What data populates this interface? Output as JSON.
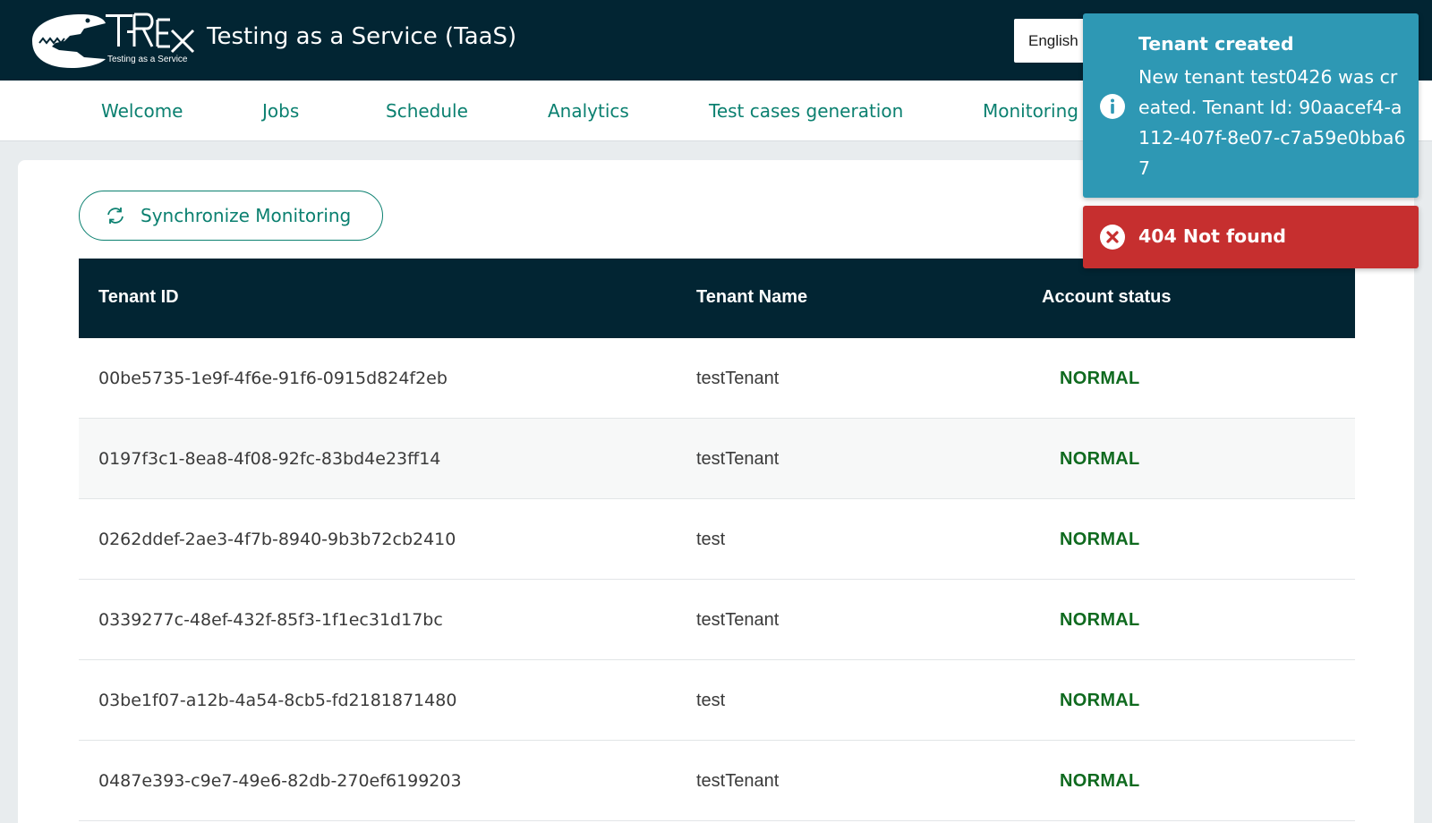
{
  "header": {
    "logo_text": "T-Rex",
    "logo_subtitle": "Testing as a Service",
    "title": "Testing as a Service (TaaS)",
    "language": "English"
  },
  "nav": {
    "items": [
      {
        "label": "Welcome"
      },
      {
        "label": "Jobs"
      },
      {
        "label": "Schedule"
      },
      {
        "label": "Analytics"
      },
      {
        "label": "Test cases generation"
      },
      {
        "label": "Monitoring"
      }
    ]
  },
  "main": {
    "sync_button_label": "Synchronize Monitoring",
    "sync_icon": "refresh-icon"
  },
  "table": {
    "columns": [
      "Tenant ID",
      "Tenant Name",
      "Account status"
    ],
    "rows": [
      {
        "id": "00be5735-1e9f-4f6e-91f6-0915d824f2eb",
        "name": "testTenant",
        "status": "NORMAL"
      },
      {
        "id": "0197f3c1-8ea8-4f08-92fc-83bd4e23ff14",
        "name": "testTenant",
        "status": "NORMAL"
      },
      {
        "id": "0262ddef-2ae3-4f7b-8940-9b3b72cb2410",
        "name": "test",
        "status": "NORMAL"
      },
      {
        "id": "0339277c-48ef-432f-85f3-1f1ec31d17bc",
        "name": "testTenant",
        "status": "NORMAL"
      },
      {
        "id": "03be1f07-a12b-4a54-8cb5-fd2181871480",
        "name": "test",
        "status": "NORMAL"
      },
      {
        "id": "0487e393-c9e7-49e6-82db-270ef6199203",
        "name": "testTenant",
        "status": "NORMAL"
      }
    ]
  },
  "toasts": {
    "info": {
      "title": "Tenant created",
      "message": "New tenant test0426 was created. Tenant Id: 90aacef4-a112-407f-8e07-c7a59e0bba67",
      "icon": "info-icon"
    },
    "error": {
      "title": "404 Not found",
      "icon": "error-x-icon"
    }
  },
  "colors": {
    "header_bg": "#022533",
    "accent": "#0b8070",
    "status_normal": "#0f6a1f",
    "toast_info": "#2e98b4",
    "toast_error": "#c62f2f"
  }
}
